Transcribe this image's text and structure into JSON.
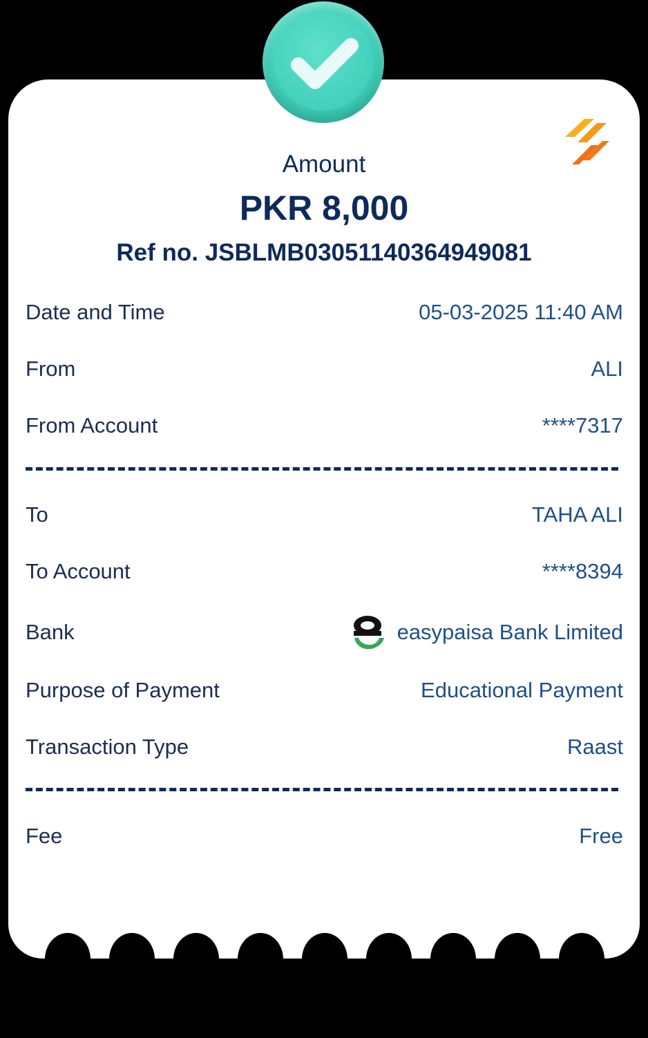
{
  "header": {
    "amount_label": "Amount",
    "amount_value": "PKR 8,000",
    "ref_line": "Ref no. JSBLMB03051140364949081"
  },
  "details": {
    "date_label": "Date and Time",
    "date_value": "05-03-2025 11:40 AM",
    "from_label": "From",
    "from_value": "ALI",
    "from_account_label": "From Account",
    "from_account_value": "****7317",
    "to_label": "To",
    "to_value": "TAHA ALI",
    "to_account_label": "To Account",
    "to_account_value": "****8394",
    "bank_label": "Bank",
    "bank_value": "easypaisa Bank Limited",
    "purpose_label": "Purpose of Payment",
    "purpose_value": "Educational Payment",
    "type_label": "Transaction Type",
    "type_value": "Raast",
    "fee_label": "Fee",
    "fee_value": "Free"
  },
  "colors": {
    "background": "#000000",
    "card": "#ffffff",
    "primary_text": "#0e2a5c",
    "value_text": "#1f4f8a",
    "success_badge": "#43d1bb",
    "brand_orange": "#f28b1e"
  },
  "icons": {
    "badge": "check-icon",
    "brand": "brand-logo-icon",
    "bank": "easypaisa-logo-icon"
  }
}
